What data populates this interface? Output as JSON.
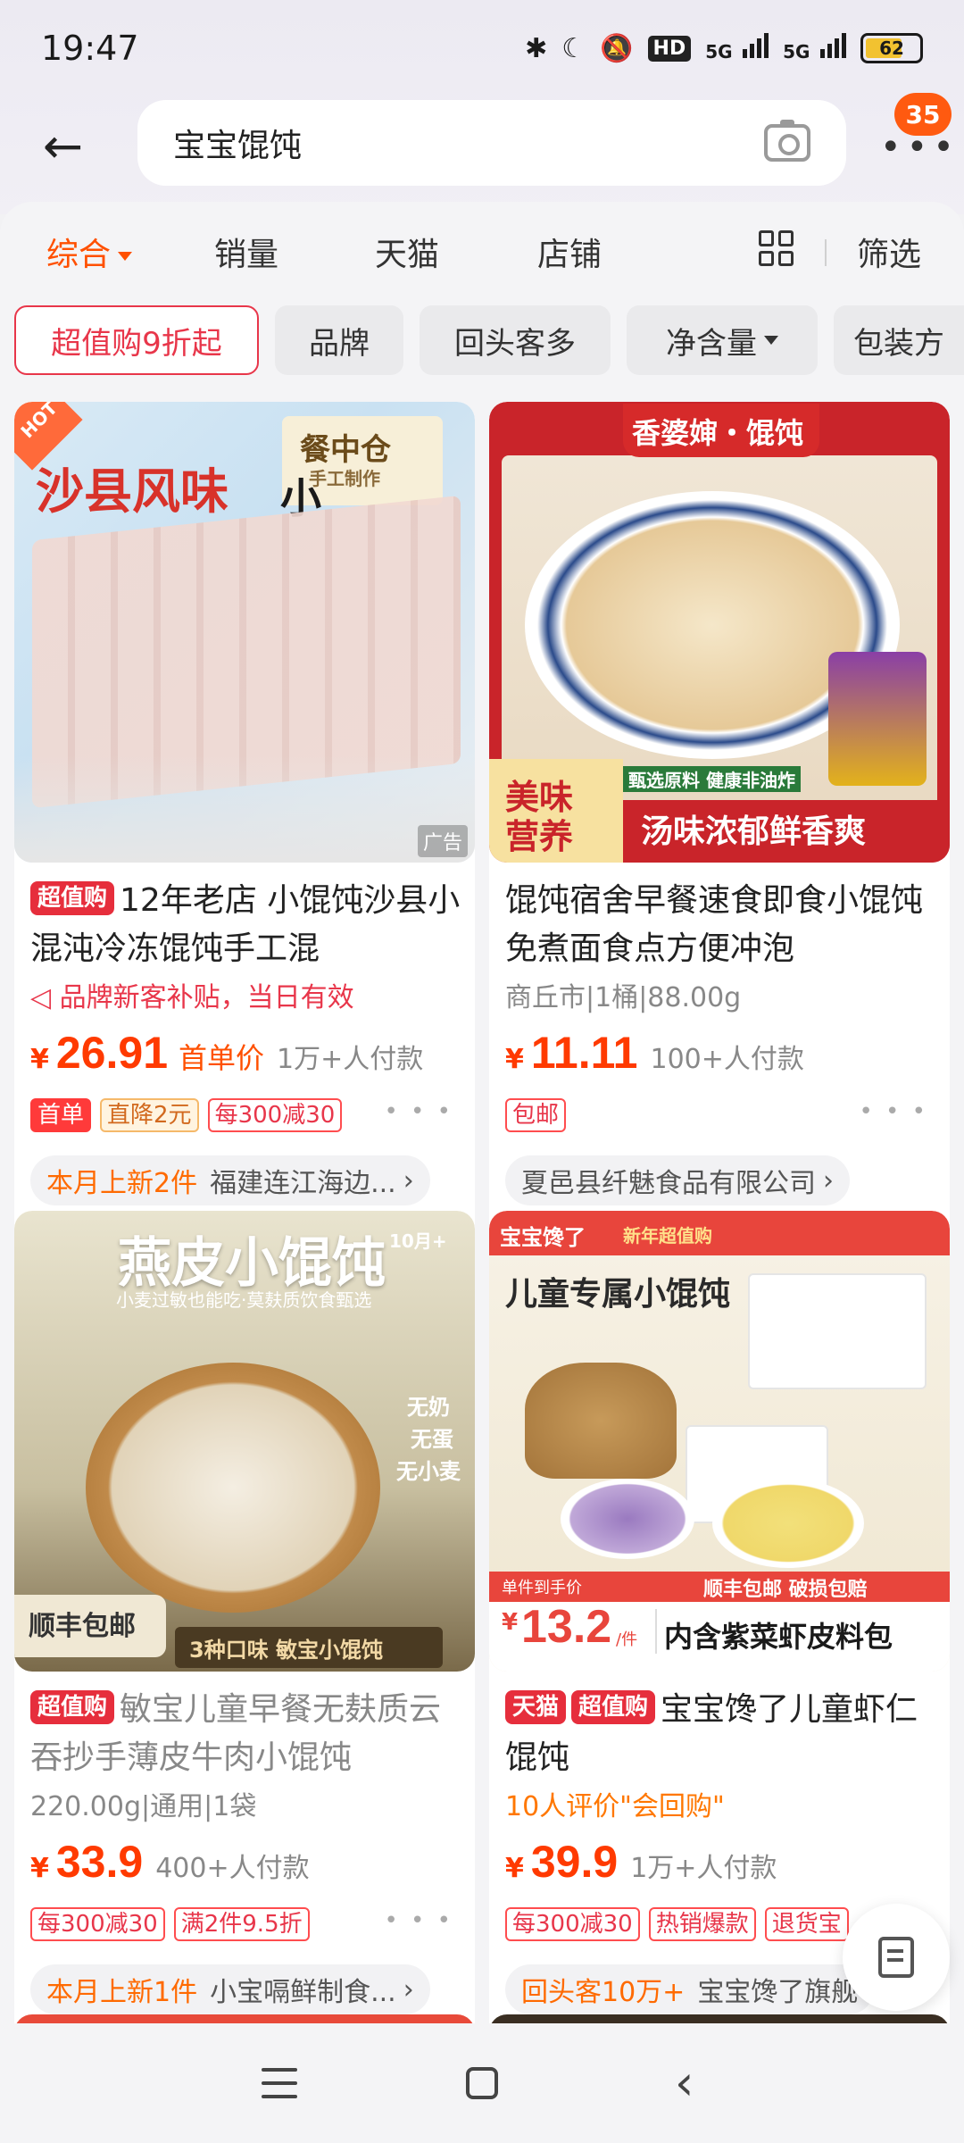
{
  "status_bar": {
    "time": "19:47",
    "hd_label": "HD",
    "sig1_label": "5G",
    "sig2_label": "5G",
    "battery": "62"
  },
  "search": {
    "query": "宝宝馄饨",
    "notification_count": "35"
  },
  "sort_tabs": [
    {
      "label": "综合"
    },
    {
      "label": "销量"
    },
    {
      "label": "天猫"
    },
    {
      "label": "店铺"
    },
    {
      "label": "筛选"
    }
  ],
  "filter_chips": [
    {
      "label": "超值购9折起"
    },
    {
      "label": "品牌"
    },
    {
      "label": "回头客多"
    },
    {
      "label": "净含量"
    },
    {
      "label": "包装方"
    }
  ],
  "products": [
    {
      "image_texts": {
        "hot": "HOT",
        "title": "沙县风味",
        "brand": "餐中仓",
        "ad": "广告",
        "small": "小",
        "sub": "手工制作"
      },
      "tag": "超值购",
      "title": "12年老店 小馄饨沙县小混沌冷冻馄饨手工混",
      "sub": "品牌新客补贴，当日有效",
      "price_symbol": "¥",
      "price": "26.91",
      "price_note": "首单价",
      "sold": "1万+人付款",
      "promos": [
        "首单",
        "直降2元",
        "每300减30"
      ],
      "store_highlight": "本月上新2件",
      "store": "福建连江海边..."
    },
    {
      "image_texts": {
        "banner": "香婆婶・馄饨",
        "left1": "美味",
        "left2": "营养",
        "slogan": "汤味浓郁鲜香爽",
        "small": "甄选原料 健康非油炸"
      },
      "title": "馄饨宿舍早餐速食即食小馄饨免煮面食点方便冲泡",
      "sub": "商丘市|1桶|88.00g",
      "price_symbol": "¥",
      "price": "11.11",
      "sold": "100+人付款",
      "promos": [
        "包邮"
      ],
      "store": "夏邑县纤魅食品有限公司"
    },
    {
      "image_texts": {
        "title": "燕皮小馄饨",
        "month": "10月+",
        "sub": "小麦过敏也能吃·莫麸质饮食甄选",
        "side1": "无奶",
        "side2": "无蛋",
        "side3": "无小麦",
        "ship": "顺丰包邮",
        "flavors": "3种口味  敏宝小馄饨"
      },
      "tag": "超值购",
      "title": "敏宝儿童早餐无麸质云吞抄手薄皮牛肉小馄饨",
      "sub": "220.00g|通用|1袋",
      "price_symbol": "¥",
      "price": "33.9",
      "sold": "400+人付款",
      "promos": [
        "每300减30",
        "满2件9.5折"
      ],
      "store_highlight": "本月上新1件",
      "store": "小宝嗝鲜制食..."
    },
    {
      "image_texts": {
        "brand": "宝宝馋了",
        "event": "新年超值购",
        "title": "儿童专属小馄饨",
        "price_label": "单件到手价",
        "ship": "顺丰包邮 破损包赔",
        "price": "13.2",
        "unit": "/件",
        "slogan": "内含紫菜虾皮料包"
      },
      "tags": [
        "天猫",
        "超值购"
      ],
      "title": "宝宝馋了儿童虾仁馄饨",
      "sub": "10人评价\"会回购\"",
      "price_symbol": "¥",
      "price": "39.9",
      "sold": "1万+人付款",
      "promos": [
        "每300减30",
        "热销爆款",
        "退货宝"
      ],
      "store_highlight": "回头客10万+",
      "store": "宝宝馋了旗舰"
    }
  ]
}
